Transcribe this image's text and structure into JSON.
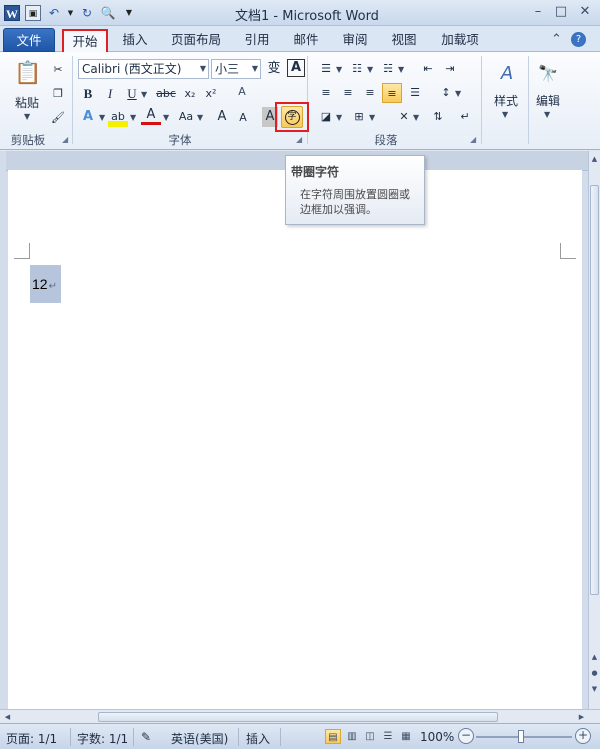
{
  "titlebar": {
    "title": "文档1 - Microsoft Word",
    "app_icon": "W",
    "quick_access": [
      "save-icon",
      "undo-icon",
      "redo-icon",
      "print-preview-icon",
      "customize-qa-icon"
    ]
  },
  "tabs": {
    "file": "文件",
    "home": "开始",
    "insert": "插入",
    "page_layout": "页面布局",
    "references": "引用",
    "mailings": "邮件",
    "review": "审阅",
    "view": "视图",
    "addins": "加载项"
  },
  "ribbon": {
    "clipboard": {
      "label": "剪贴板",
      "paste": "粘贴"
    },
    "font": {
      "label": "字体",
      "font_name": "Calibri (西文正文)",
      "font_size": "小三",
      "phonetic": "变",
      "char_border": "A",
      "bold": "B",
      "italic": "I",
      "underline": "U",
      "strike": "abc",
      "subscript": "x₂",
      "superscript": "x²",
      "clear_format": "A",
      "text_effects": "A",
      "highlight": "ab",
      "font_color": "A",
      "change_case": "Aa",
      "grow_font": "A",
      "shrink_font": "A",
      "char_shading": "A",
      "enclose_char": "字"
    },
    "paragraph": {
      "label": "段落"
    },
    "styles": {
      "label": "样式"
    },
    "editing": {
      "label": "编辑"
    }
  },
  "tooltip": {
    "title": "带圈字符",
    "body": "在字符周围放置圆圈或边框加以强调。"
  },
  "document": {
    "text": "12",
    "paragraph_mark": "↵"
  },
  "statusbar": {
    "page": "页面: 1/1",
    "words": "字数: 1/1",
    "language": "英语(美国)",
    "insert_mode": "插入",
    "zoom": "100%",
    "zoom_minus": "−",
    "zoom_plus": "+"
  },
  "colors": {
    "file_tab": "#2b5797",
    "highlight_box": "#e02020",
    "selection": "#b7c5dc",
    "active_button": "#f7c95a"
  }
}
